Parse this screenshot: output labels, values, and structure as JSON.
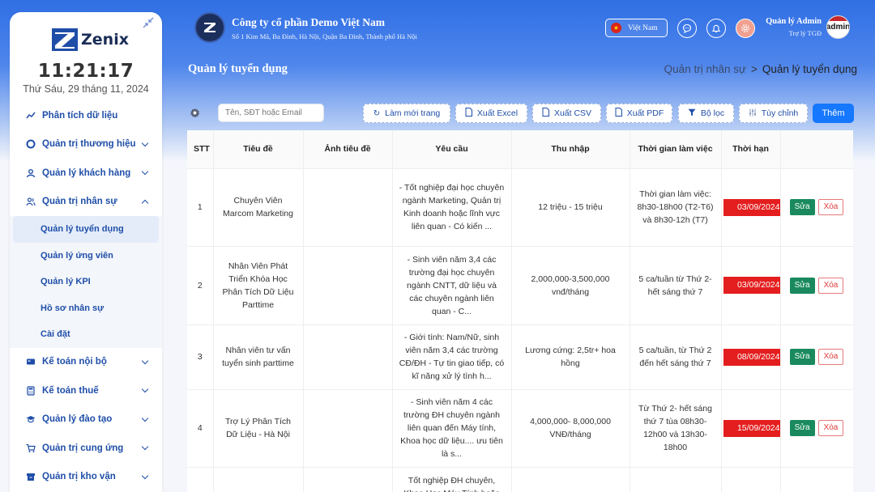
{
  "sidebar": {
    "logo_text": "Zenix",
    "time": "11:21:17",
    "date": "Thứ Sáu, 29 tháng 11, 2024",
    "items": [
      {
        "label": "Phân tích dữ liệu",
        "icon": "chart-line-icon"
      },
      {
        "label": "Quản trị thương hiệu",
        "icon": "target-icon"
      },
      {
        "label": "Quản lý khách hàng",
        "icon": "user-icon"
      },
      {
        "label": "Quản trị nhân sự",
        "icon": "users-icon"
      },
      {
        "label": "Kế toán nội bộ",
        "icon": "card-icon"
      },
      {
        "label": "Kế toán thuế",
        "icon": "calculator-icon"
      },
      {
        "label": "Quản lý đào tạo",
        "icon": "graduation-icon"
      },
      {
        "label": "Quản trị cung ứng",
        "icon": "cart-icon"
      },
      {
        "label": "Quản trị kho vận",
        "icon": "warehouse-icon"
      }
    ],
    "sub_items": [
      {
        "label": "Quản lý tuyển dụng"
      },
      {
        "label": "Quản lý ứng viên"
      },
      {
        "label": "Quản lý KPI"
      },
      {
        "label": "Hồ sơ nhân sự"
      },
      {
        "label": "Cài đặt"
      }
    ]
  },
  "header": {
    "company_name": "Công ty cổ phần Demo Việt Nam",
    "company_address": "Số 1 Kim Mã, Ba Đình, Hà Nội, Quận Ba Đình, Thành phố Hà Nội",
    "language": "Việt Nam",
    "user_name": "Quản lý Admin",
    "user_role": "Trợ lý TGĐ",
    "avatar_text": "admin"
  },
  "page": {
    "title": "Quản lý tuyển dụng",
    "breadcrumb_parent": "Quản trị nhân sự",
    "breadcrumb_sep": ">",
    "breadcrumb_current": "Quản lý tuyển dụng"
  },
  "toolbar": {
    "search_placeholder": "Tên, SĐT hoặc Email",
    "refresh_label": "Làm mới trang",
    "excel_label": "Xuất Excel",
    "csv_label": "Xuất CSV",
    "pdf_label": "Xuất PDF",
    "filter_label": "Bộ lọc",
    "customize_label": "Tùy chỉnh",
    "add_label": "Thêm"
  },
  "table": {
    "headers": {
      "stt": "STT",
      "title": "Tiêu đề",
      "image": "Ảnh tiêu đề",
      "requirement": "Yêu cầu",
      "income": "Thu nhập",
      "work_time": "Thời gian làm việc",
      "deadline": "Thời hạn"
    },
    "edit_label": "Sửa",
    "delete_label": "Xóa",
    "rows": [
      {
        "stt": "1",
        "title": "Chuyên Viên Marcom Marketing",
        "requirement": "- Tốt nghiệp đại học chuyên ngành Marketing, Quản trị Kinh doanh hoặc lĩnh vực liên quan - Có kiến ...",
        "income": "12 triệu - 15 triệu",
        "work_time": "Thời gian làm việc: 8h30-18h00 (T2-T6) và 8h30-12h (T7)",
        "deadline": "03/09/2024"
      },
      {
        "stt": "2",
        "title": "Nhân Viên Phát Triển Khóa Học Phân Tích Dữ Liệu Parttime",
        "requirement": "- Sinh viên năm 3,4 các trường đại học chuyên ngành CNTT, dữ liệu và các chuyên ngành liên quan - C...",
        "income": "2,000,000-3,500,000 vnđ/tháng",
        "work_time": "5 ca/tuần từ Thứ 2- hết sáng thứ 7",
        "deadline": "03/09/2024"
      },
      {
        "stt": "3",
        "title": "Nhân viên tư vấn tuyển sinh parttime",
        "requirement": "- Giới tính: Nam/Nữ, sinh viên năm 3,4 các trường CĐ/ĐH - Tự tin giao tiếp, có kĩ năng xử lý tình h...",
        "income": "Lương cứng: 2,5tr+ hoa hồng",
        "work_time": "5 ca/tuần, từ Thứ 2 đến hết sáng thứ 7",
        "deadline": "08/09/2024"
      },
      {
        "stt": "4",
        "title": "Trợ Lý Phân Tích Dữ Liệu - Hà Nội",
        "requirement": "- Sinh viên năm 4 các trường ĐH chuyên ngành liên quan đến Máy tính, Khoa học dữ liệu.... ưu tiên là s...",
        "income": "4,000,000- 8,000,000 VNĐ/tháng",
        "work_time": "Từ Thứ 2- hết sáng thứ 7 tùa 08h30-12h00 và 13h30-18h00",
        "deadline": "15/09/2024"
      },
      {
        "stt": "",
        "title": "",
        "requirement": "Tốt nghiệp ĐH chuyên, Khoa Học Máy Tính hoặc",
        "income": "",
        "work_time": "",
        "deadline": ""
      }
    ]
  },
  "colors": {
    "primary": "#1677ff",
    "header_gradient_top": "#2f6fe4",
    "nav_text": "#1f4ea8",
    "deadline_badge": "#e41e1e",
    "edit_button": "#1a8a5e",
    "delete_border": "#e67a7a"
  }
}
